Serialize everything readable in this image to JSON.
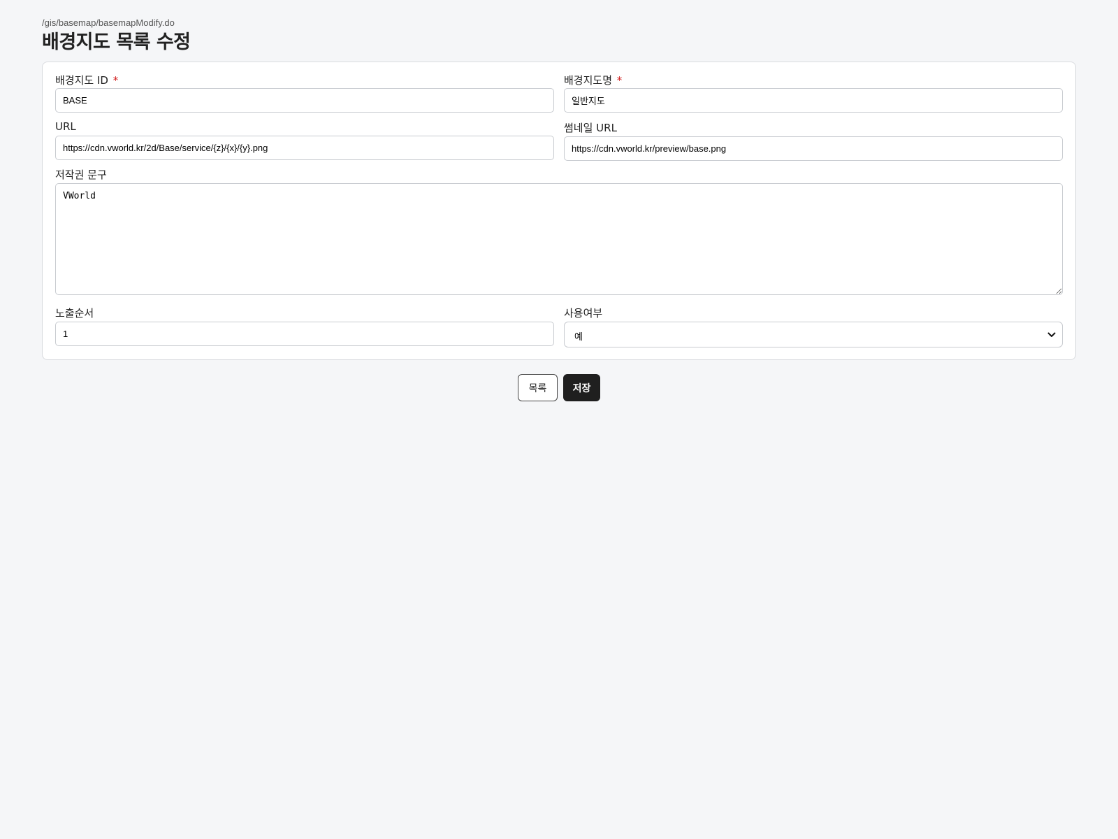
{
  "header": {
    "path": "/gis/basemap/basemapModify.do",
    "title": "배경지도 목록 수정"
  },
  "form": {
    "basemap_id": {
      "label": "배경지도 ID",
      "required_mark": "*",
      "value": "BASE"
    },
    "basemap_name": {
      "label": "배경지도명",
      "required_mark": "*",
      "value": "일반지도"
    },
    "url": {
      "label": "URL",
      "value": "https://cdn.vworld.kr/2d/Base/service/{z}/{x}/{y}.png"
    },
    "thumbnail_url": {
      "label": "썸네일 URL",
      "value": "https://cdn.vworld.kr/preview/base.png"
    },
    "copyright": {
      "label": "저작권 문구",
      "value": "VWorld"
    },
    "display_order": {
      "label": "노출순서",
      "value": "1"
    },
    "use_yn": {
      "label": "사용여부",
      "selected": "예"
    }
  },
  "actions": {
    "list_label": "목록",
    "save_label": "저장"
  },
  "colors": {
    "background": "#f5f6f8",
    "required": "#d11a1a",
    "primary_button": "#1f1f1f"
  },
  "icons": {
    "select_arrow": "chevron-down-icon"
  }
}
